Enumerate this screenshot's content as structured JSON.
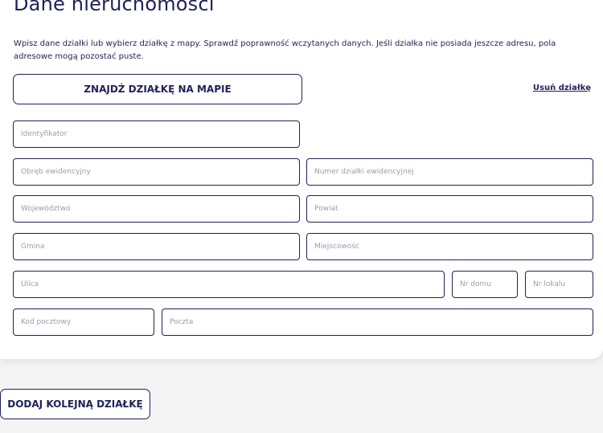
{
  "section": {
    "title": "Dane nieruchomości",
    "description": "Wpisz dane działki lub wybierz działkę z mapy. Sprawdź poprawność wczytanych danych. Jeśli działka nie posiada jeszcze adresu, pola adresowe mogą pozostać puste."
  },
  "actions": {
    "find_on_map": "ZNAJDŹ DZIAŁKĘ NA MAPIE",
    "remove_plot": "Usuń działkę",
    "add_another_plot": "DODAJ KOLEJNĄ DZIAŁKĘ"
  },
  "fields": {
    "identifier": {
      "placeholder": "Identyfikator",
      "value": ""
    },
    "precinct": {
      "placeholder": "Obręb ewidencyjny",
      "value": ""
    },
    "plot_number": {
      "placeholder": "Numer działki ewidencyjnej",
      "value": ""
    },
    "voivodeship": {
      "placeholder": "Województwo",
      "value": ""
    },
    "county": {
      "placeholder": "Powiat",
      "value": ""
    },
    "commune": {
      "placeholder": "Gmina",
      "value": ""
    },
    "locality": {
      "placeholder": "Miejscowość",
      "value": ""
    },
    "street": {
      "placeholder": "Ulica",
      "value": ""
    },
    "house_number": {
      "placeholder": "Nr domu",
      "value": ""
    },
    "apartment_number": {
      "placeholder": "Nr lokalu",
      "value": ""
    },
    "postal_code": {
      "placeholder": "Kod pocztowy",
      "value": ""
    },
    "post_office": {
      "placeholder": "Poczta",
      "value": ""
    }
  },
  "colors": {
    "primary": "#1e2157",
    "card_background": "#ffffff",
    "page_background": "#f4f4f5",
    "placeholder": "#9a9cb1"
  }
}
